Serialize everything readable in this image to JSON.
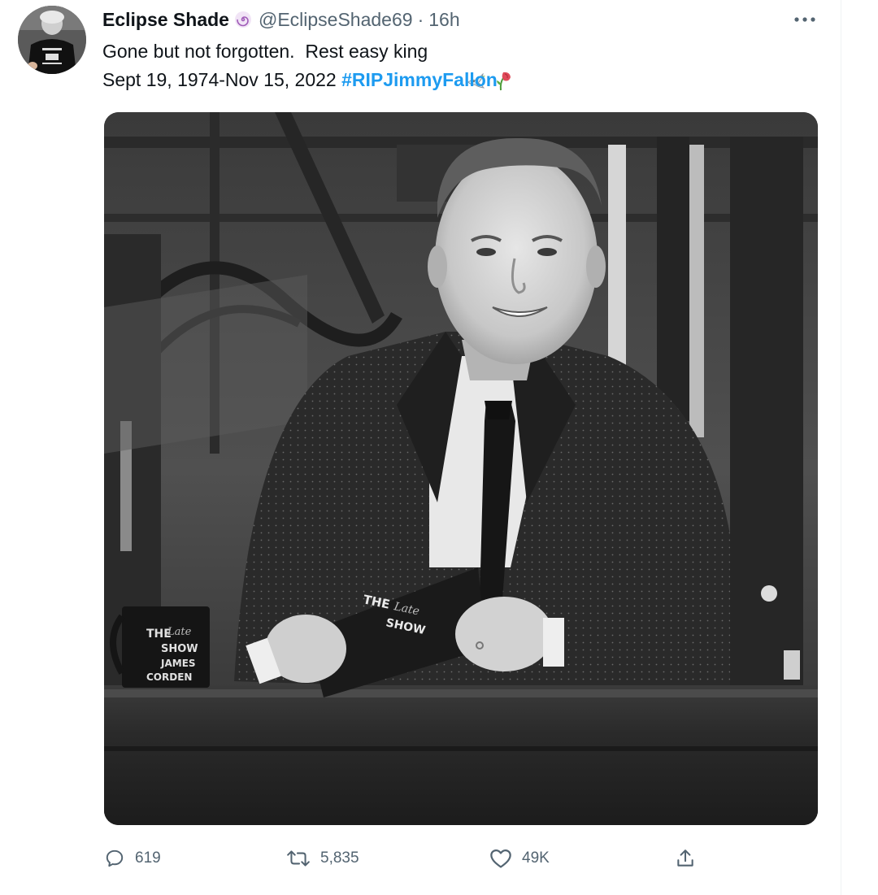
{
  "tweet": {
    "author": {
      "display_name": "Eclipse Shade",
      "handle": "@EclipseShade69",
      "separator": "·",
      "time": "16h",
      "avatar_icon": "profile-photo"
    },
    "text": {
      "line1": "Gone but not forgotten.  Rest easy king",
      "line1_emojis": [
        "dove-emoji",
        "wilted-rose-emoji"
      ],
      "line2_prefix": "Sept 19, 1974-Nov 15, 2022 ",
      "hashtag": "#RIPJimmyFallon"
    },
    "media": {
      "type": "photo",
      "style": "black-and-white",
      "mug_text": [
        "THE",
        "Late",
        "SHOW",
        "JAMES",
        "CORDEN"
      ],
      "card_text": [
        "THE",
        "Late",
        "SHOW"
      ]
    },
    "actions": {
      "reply_count": "619",
      "retweet_count": "5,835",
      "like_count": "49K",
      "share_icon": "share-icon"
    }
  },
  "colors": {
    "text_primary": "#0f1419",
    "text_secondary": "#536471",
    "link_blue": "#1d9bf0",
    "divider": "#eff3f4"
  }
}
